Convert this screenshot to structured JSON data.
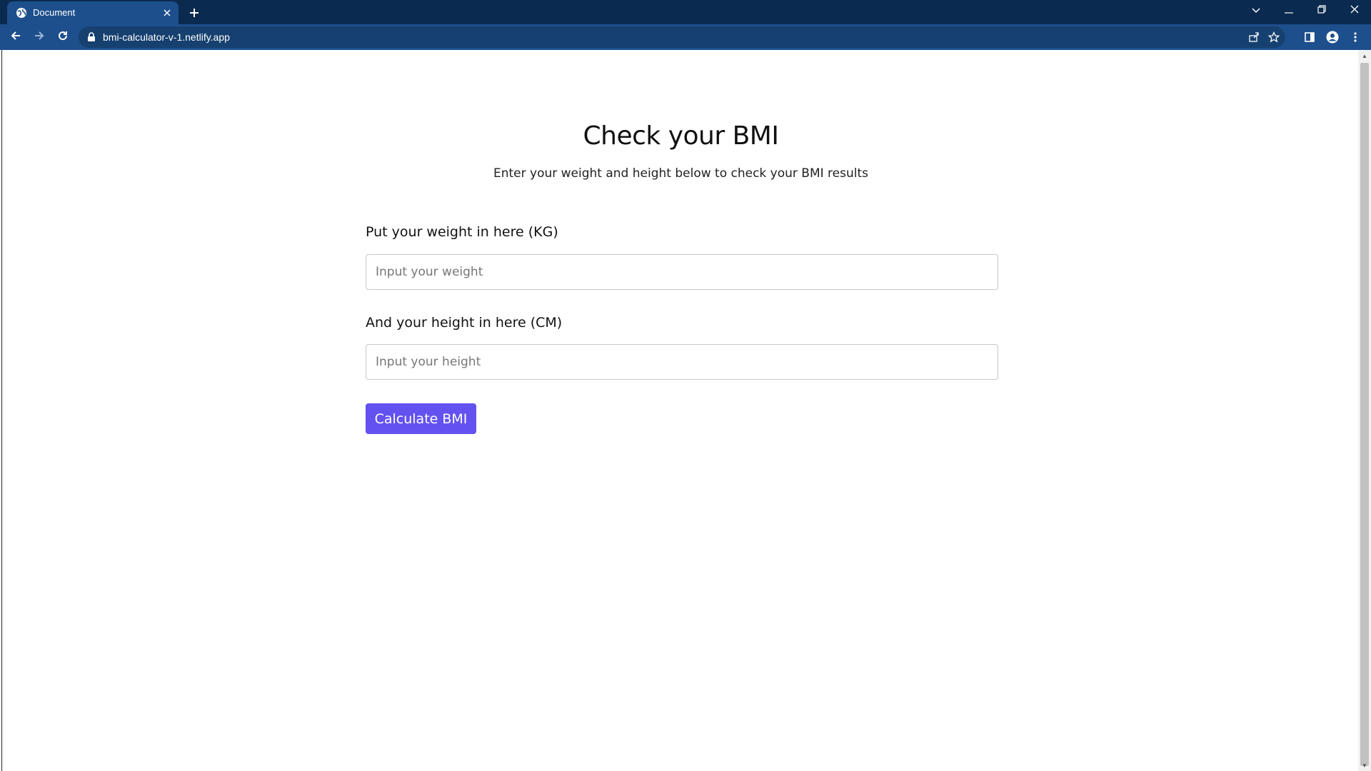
{
  "browser": {
    "tab_title": "Document",
    "url": "bmi-calculator-v-1.netlify.app"
  },
  "page": {
    "title": "Check your BMI",
    "subtitle": "Enter your weight and height below to check your BMI results",
    "weight_label": "Put your weight in here (KG)",
    "weight_placeholder": "Input your weight",
    "weight_value": "",
    "height_label": "And your height in here (CM)",
    "height_placeholder": "Input your height",
    "height_value": "",
    "button_label": "Calculate BMI"
  },
  "colors": {
    "tabstrip": "#0b2a4f",
    "toolbar": "#1d4f8c",
    "button": "#6352f0"
  },
  "icons": [
    "globe-icon",
    "close-icon",
    "plus-icon",
    "back-icon",
    "forward-icon",
    "reload-icon",
    "lock-icon",
    "share-icon",
    "star-icon",
    "side-panel-icon",
    "profile-icon",
    "menu-icon",
    "chevron-down-icon",
    "minimize-icon",
    "restore-icon"
  ]
}
